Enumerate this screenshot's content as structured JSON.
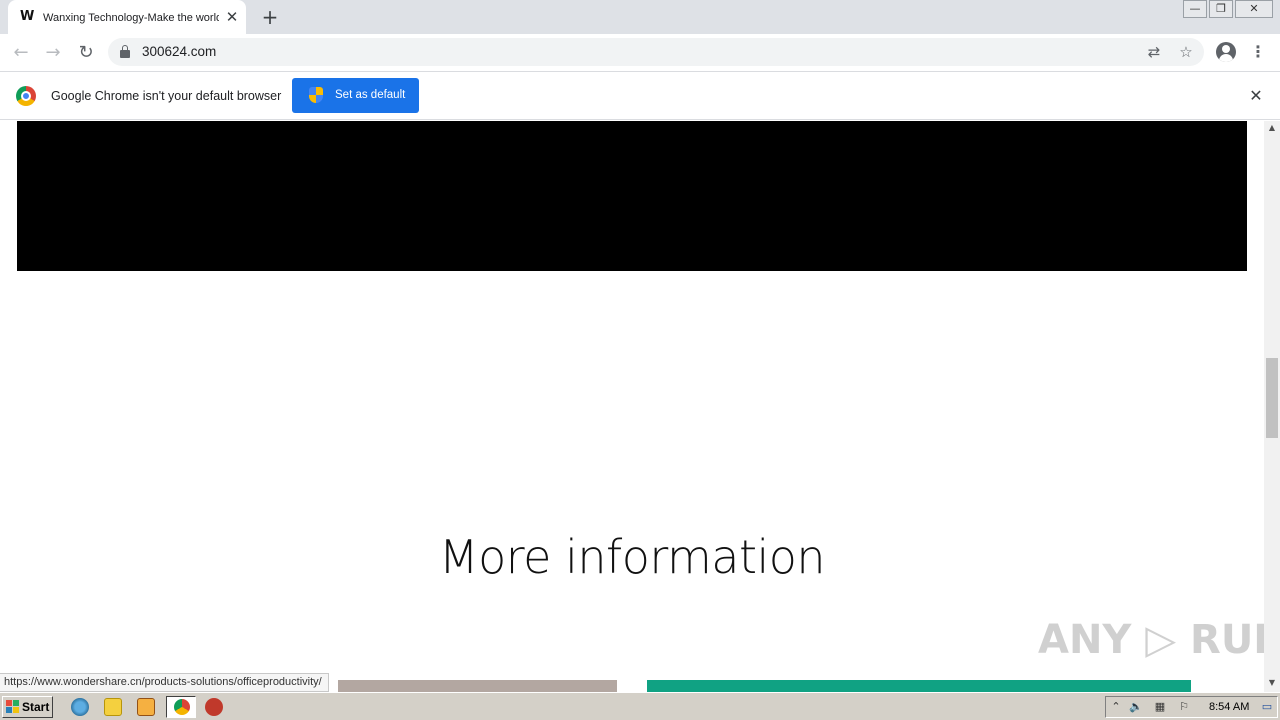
{
  "browser": {
    "tab": {
      "title": "Wanxing Technology-Make the world more creative",
      "favicon_text": "W",
      "close_glyph": "✕"
    },
    "new_tab_glyph": "+",
    "window_controls": {
      "minimize": "—",
      "restore": "❐",
      "close": "✕"
    },
    "nav": {
      "back": "←",
      "forward": "→",
      "reload": "↻"
    },
    "address": {
      "url": "300624.com"
    },
    "icons": {
      "translate": "⇄",
      "bookmark": "☆",
      "menu": "⋮"
    }
  },
  "infobar": {
    "message": "Google Chrome isn't your default browser",
    "button_label": "Set as default",
    "close_glyph": "✕"
  },
  "page": {
    "heading": "More information"
  },
  "status_bar": {
    "url": "https://www.wondershare.cn/products-solutions/officeproductivity/"
  },
  "watermark": {
    "text": "ANY ▷ RUN"
  },
  "scrollbar": {
    "up": "▲",
    "down": "▼"
  },
  "taskbar": {
    "start_label": "Start",
    "clock": "8:54 AM",
    "tray_glyphs": {
      "expand": "⌃",
      "volume": "🔈",
      "network": "▦",
      "flag": "⚐",
      "desktop": "▭"
    }
  },
  "colors": {
    "chrome_blue": "#1a73e8",
    "video_block": "#000000",
    "card_right": "#10a283",
    "card_left": "#b3a7a1"
  }
}
